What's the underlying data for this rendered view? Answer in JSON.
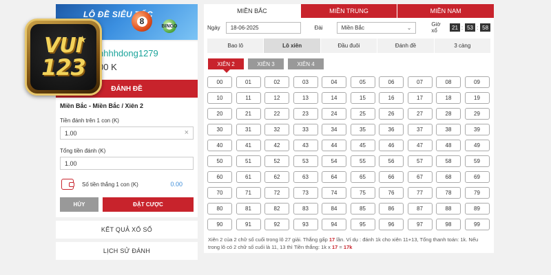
{
  "banner": {
    "title": "LÔ ĐỀ SIÊU TỐC",
    "ball_main": "8",
    "ball_small": "BINGO"
  },
  "logo": {
    "line1": "VUI",
    "line2": "123"
  },
  "user": {
    "username": "nhhhdong1279",
    "balance": "00 K"
  },
  "left": {
    "bet_button": "ĐÁNH ĐỀ",
    "form_title": "Miền Bắc - Miền Bắc / Xiên 2",
    "stake_label": "Tiền đánh trên 1 con (K)",
    "stake_value": "1.00",
    "total_label": "Tổng tiền đánh (K)",
    "total_value": "1.00",
    "win_label": "Số tiền thắng 1 con (K)",
    "win_value": "0.00",
    "cancel_button": "HỦY",
    "place_button": "ĐẶT CƯỢC",
    "results_link": "KẾT QUẢ XỔ SỐ",
    "history_link": "LỊCH SỬ ĐÁNH"
  },
  "regions": [
    {
      "label": "MIỀN BẮC",
      "active": true
    },
    {
      "label": "MIỀN TRUNG",
      "active": false
    },
    {
      "label": "MIỀN NAM",
      "active": false
    }
  ],
  "filters": {
    "date_label": "Ngày",
    "date_value": "18-06-2025",
    "dai_label": "Đài",
    "dai_value": "Miền Bắc",
    "clock_label": "Giờ xổ",
    "clock": [
      "21",
      "53",
      "58"
    ]
  },
  "bet_types": [
    {
      "label": "Bao lô",
      "active": false
    },
    {
      "label": "Lô xiên",
      "active": true
    },
    {
      "label": "Đầu đuôi",
      "active": false
    },
    {
      "label": "Đánh đề",
      "active": false
    },
    {
      "label": "3 càng",
      "active": false
    }
  ],
  "sub_tabs": [
    {
      "label": "XIÊN 2",
      "active": true
    },
    {
      "label": "XIÊN 3",
      "active": false
    },
    {
      "label": "XIÊN 4",
      "active": false
    }
  ],
  "numbers": [
    "00",
    "01",
    "02",
    "03",
    "04",
    "05",
    "06",
    "07",
    "08",
    "09",
    "10",
    "11",
    "12",
    "13",
    "14",
    "15",
    "16",
    "17",
    "18",
    "19",
    "20",
    "21",
    "22",
    "23",
    "24",
    "25",
    "26",
    "27",
    "28",
    "29",
    "30",
    "31",
    "32",
    "33",
    "34",
    "35",
    "36",
    "37",
    "38",
    "39",
    "40",
    "41",
    "42",
    "43",
    "44",
    "45",
    "46",
    "47",
    "48",
    "49",
    "50",
    "51",
    "52",
    "53",
    "54",
    "55",
    "56",
    "57",
    "58",
    "59",
    "60",
    "61",
    "62",
    "63",
    "64",
    "65",
    "66",
    "67",
    "68",
    "69",
    "70",
    "71",
    "72",
    "73",
    "74",
    "75",
    "76",
    "77",
    "78",
    "79",
    "80",
    "81",
    "82",
    "83",
    "84",
    "85",
    "86",
    "87",
    "88",
    "89",
    "90",
    "91",
    "92",
    "93",
    "94",
    "95",
    "96",
    "97",
    "98",
    "99"
  ],
  "note": {
    "p1": "Xiên 2 của 2 chữ số cuối trong lô 27 giải. Thắng gấp ",
    "m1": "17",
    "p2": " lần. Ví dụ : đánh 1k cho xiên 11+13, Tổng thanh toán: 1k. Nếu trong lô có 2 chữ số cuối là 11, 13 thì Tiền thắng: 1k x ",
    "m2": "17",
    "p3": " = ",
    "m3": "17k"
  }
}
